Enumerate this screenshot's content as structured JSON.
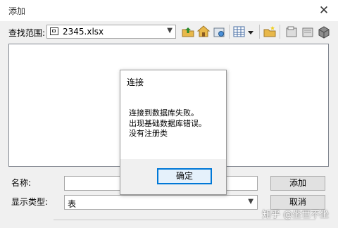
{
  "window": {
    "title": "添加",
    "close_glyph": "✕"
  },
  "lookin": {
    "label": "查找范围:",
    "value": "2345.xlsx",
    "icon": "spreadsheet-file-icon"
  },
  "toolbar": {
    "icons": [
      "folder-up-icon",
      "home-icon",
      "go-to-folder-icon",
      "view-list-icon",
      "view-dropdown-icon",
      "new-folder-icon",
      "connect-folder-icon",
      "disconnect-folder-icon",
      "database-icon"
    ]
  },
  "form": {
    "name_label": "名称:",
    "name_value": "",
    "type_label": "显示类型:",
    "type_value": "表"
  },
  "buttons": {
    "add": "添加",
    "cancel": "取消"
  },
  "dialog": {
    "title": "连接",
    "line1": "连接到数据库失败。",
    "line2": "出现基础数据库错误。",
    "line3": "没有注册类",
    "ok": "确定"
  },
  "watermark": "知乎 @坐世不坐",
  "colors": {
    "accent": "#0078d7",
    "folder": "#e8b84a"
  }
}
